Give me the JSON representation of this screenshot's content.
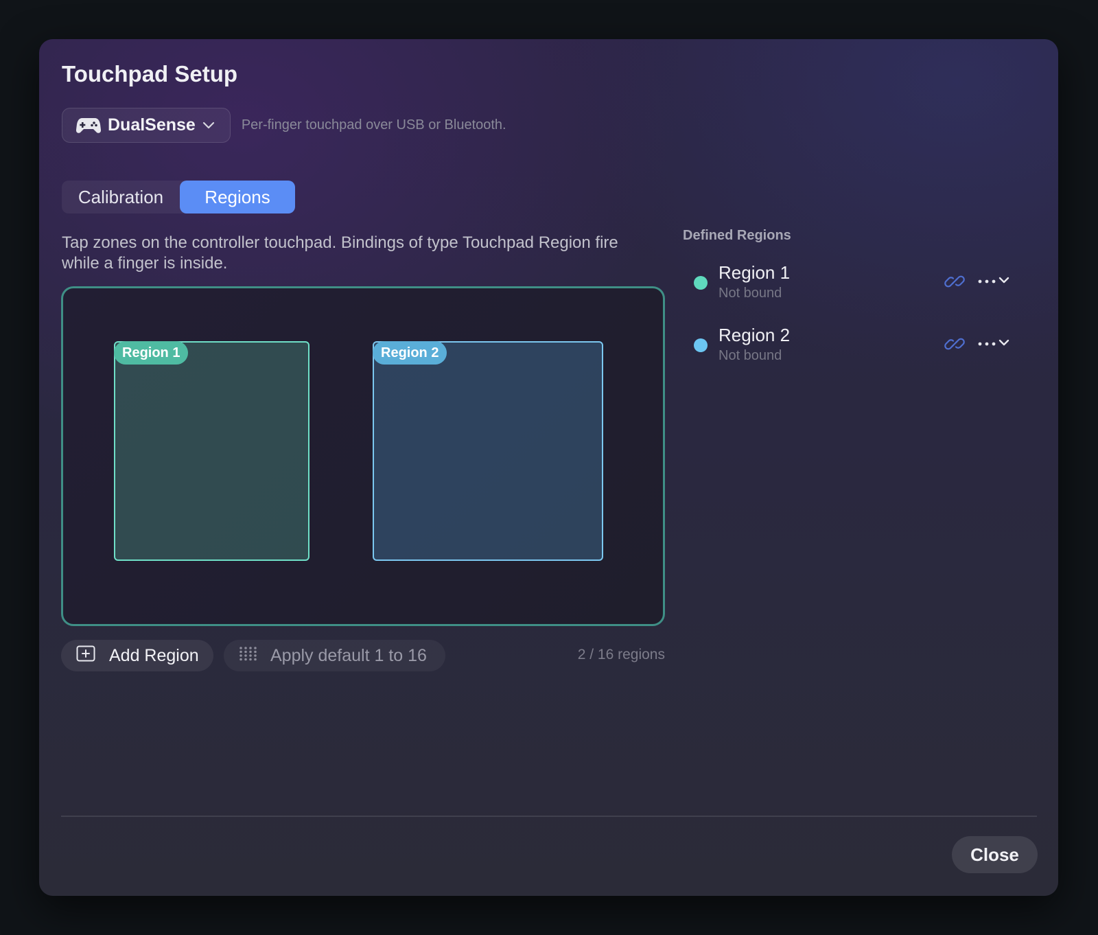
{
  "dialog": {
    "title": "Touchpad Setup",
    "device": {
      "selected": "DualSense",
      "description": "Per-finger touchpad over USB or Bluetooth."
    },
    "tabs": [
      {
        "label": "Calibration",
        "active": false
      },
      {
        "label": "Regions",
        "active": true
      }
    ],
    "help_text": "Tap zones on the controller touchpad. Bindings of type Touchpad Region fire while a finger is inside.",
    "pad": {
      "regions": [
        {
          "label": "Region 1",
          "color": "#6fe0c8"
        },
        {
          "label": "Region 2",
          "color": "#7cc8f0"
        }
      ]
    },
    "actions": {
      "add_label": "Add Region",
      "default_label": "Apply default 1 to 16",
      "count": "2 / 16 regions"
    },
    "sidebar": {
      "heading": "Defined Regions",
      "items": [
        {
          "name": "Region 1",
          "status": "Not bound",
          "color": "#5fd9bd"
        },
        {
          "name": "Region 2",
          "status": "Not bound",
          "color": "#6cc6f2"
        }
      ]
    },
    "close_label": "Close",
    "colors": {
      "accent": "#5b8df5",
      "pad_border": "#3f8f86",
      "link_icon": "#4f6fd0"
    }
  }
}
